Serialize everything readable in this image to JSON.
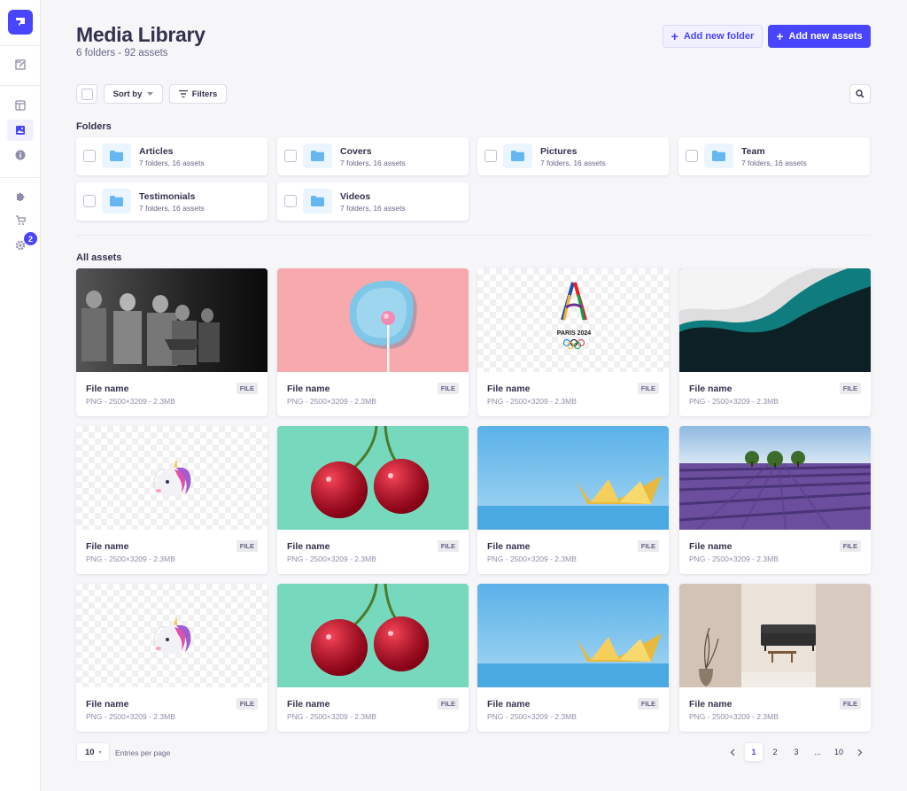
{
  "header": {
    "title": "Media Library",
    "subtitle": "6 folders - 92 assets",
    "add_folder_label": "Add new folder",
    "add_assets_label": "Add new assets"
  },
  "sidebar": {
    "items": [
      "content-manager-icon",
      "content-type-builder-icon",
      "media-library-icon",
      "info-icon",
      "plugins-icon",
      "marketplace-icon",
      "settings-icon"
    ],
    "active": "media-library-icon",
    "settings_badge": "2"
  },
  "toolbar": {
    "sort_label": "Sort by",
    "filters_label": "Filters"
  },
  "folders_section": {
    "label": "Folders",
    "items": [
      {
        "name": "Articles",
        "meta": "7 folders, 16 assets"
      },
      {
        "name": "Covers",
        "meta": "7 folders, 16 assets"
      },
      {
        "name": "Pictures",
        "meta": "7 folders, 16 assets"
      },
      {
        "name": "Team",
        "meta": "7 folders, 16 assets"
      },
      {
        "name": "Testimonials",
        "meta": "7 folders, 16 assets"
      },
      {
        "name": "Videos",
        "meta": "7 folders, 16 assets"
      }
    ]
  },
  "assets_section": {
    "label": "All assets",
    "items": [
      {
        "name": "File name",
        "meta": "PNG - 2500×3209 - 2.3MB",
        "badge": "FILE",
        "thumb": "musicians-photo"
      },
      {
        "name": "File name",
        "meta": "PNG - 2500×3209 - 2.3MB",
        "badge": "FILE",
        "thumb": "lollipop-photo"
      },
      {
        "name": "File name",
        "meta": "PNG - 2500×3209 - 2.3MB",
        "badge": "FILE",
        "thumb": "paris-2024-logo",
        "logo_text": "PARIS 2024"
      },
      {
        "name": "File name",
        "meta": "PNG - 2500×3209 - 2.3MB",
        "badge": "FILE",
        "thumb": "abstract-wave-photo"
      },
      {
        "name": "File name",
        "meta": "PNG - 2500×3209 - 2.3MB",
        "badge": "FILE",
        "thumb": "unicorn-emoji"
      },
      {
        "name": "File name",
        "meta": "PNG - 2500×3209 - 2.3MB",
        "badge": "FILE",
        "thumb": "cherries-photo"
      },
      {
        "name": "File name",
        "meta": "PNG - 2500×3209 - 2.3MB",
        "badge": "FILE",
        "thumb": "paper-boat-photo"
      },
      {
        "name": "File name",
        "meta": "PNG - 2500×3209 - 2.3MB",
        "badge": "FILE",
        "thumb": "lavender-field-photo"
      },
      {
        "name": "File name",
        "meta": "PNG - 2500×3209 - 2.3MB",
        "badge": "FILE",
        "thumb": "unicorn-emoji"
      },
      {
        "name": "File name",
        "meta": "PNG - 2500×3209 - 2.3MB",
        "badge": "FILE",
        "thumb": "cherries-photo"
      },
      {
        "name": "File name",
        "meta": "PNG - 2500×3209 - 2.3MB",
        "badge": "FILE",
        "thumb": "paper-boat-photo"
      },
      {
        "name": "File name",
        "meta": "PNG - 2500×3209 - 2.3MB",
        "badge": "FILE",
        "thumb": "living-room-photo"
      }
    ]
  },
  "pagination": {
    "per_page": "10",
    "per_page_label": "Entries per page",
    "pages": [
      "1",
      "2",
      "3",
      "...",
      "10"
    ],
    "current": "1"
  },
  "colors": {
    "primary": "#4945ff",
    "background": "#f6f6f9",
    "text": "#32324d"
  }
}
